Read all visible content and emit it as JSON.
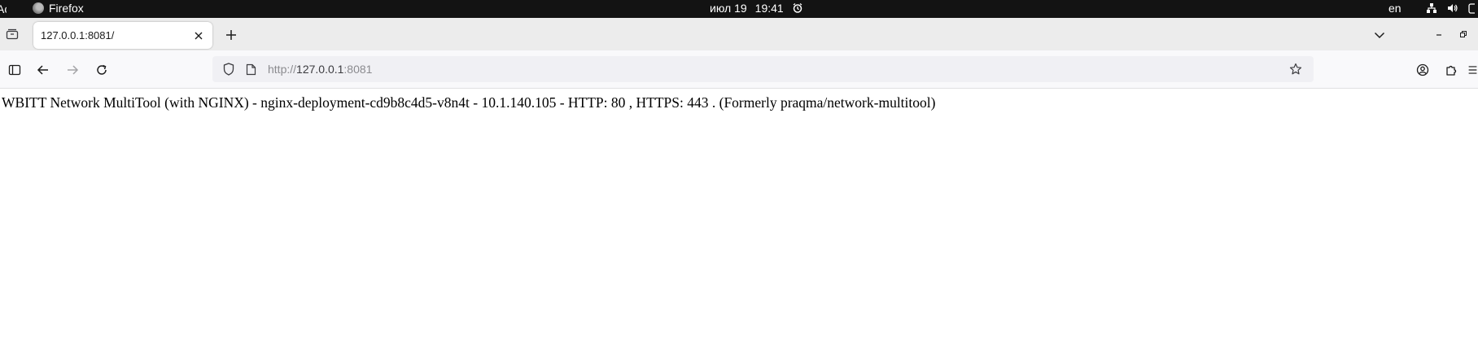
{
  "topbar": {
    "activities_label": "Activities",
    "app_name": "Firefox",
    "date": "июл 19",
    "time": "19:41",
    "language": "en"
  },
  "browser": {
    "tab": {
      "title": "127.0.0.1:8081/"
    },
    "urlbar": {
      "scheme": "http://",
      "host": "127.0.0.1",
      "port": ":8081"
    }
  },
  "page": {
    "text": "WBITT Network MultiTool (with NGINX) - nginx-deployment-cd9b8c4d5-v8n4t - 10.1.140.105 - HTTP: 80 , HTTPS: 443 . (Formerly praqma/network-multitool)"
  },
  "icons": {
    "app_logo": "firefox-icon",
    "alarm": "alarm-icon",
    "network": "network-icon",
    "volume": "volume-icon",
    "tab_overview": "tab-overview-icon",
    "close": "close-icon",
    "new_tab": "plus-icon",
    "tab_list": "chevron-down-icon",
    "minimize": "minimize-icon",
    "maximize": "maximize-icon",
    "sidebar": "sidebar-icon",
    "back": "arrow-left-icon",
    "forward": "arrow-right-icon",
    "reload": "reload-icon",
    "tracking": "shield-icon",
    "page": "page-icon",
    "bookmark": "star-icon",
    "account": "account-icon",
    "extensions": "puzzle-icon"
  },
  "colors": {
    "topbar_bg": "#131313",
    "tabstrip_bg": "#ececec",
    "toolbar_bg": "#f9f9fb",
    "urlbar_bg": "#f0f0f4"
  }
}
